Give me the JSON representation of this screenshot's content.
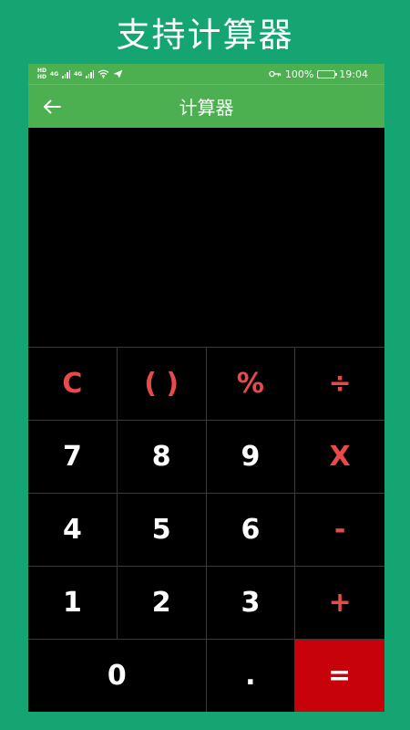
{
  "banner": {
    "title": "支持计算器"
  },
  "statusbar": {
    "hd1": "HD",
    "hd2": "HD",
    "net1": "4G",
    "net2": "4G",
    "battery_text": "100%",
    "time": "19:04"
  },
  "appbar": {
    "title": "计算器"
  },
  "display": {
    "value": ""
  },
  "keys": {
    "clear": "C",
    "parens": "( )",
    "percent": "%",
    "divide": "÷",
    "seven": "7",
    "eight": "8",
    "nine": "9",
    "multiply": "X",
    "four": "4",
    "five": "5",
    "six": "6",
    "minus": "-",
    "one": "1",
    "two": "2",
    "three": "3",
    "plus": "+",
    "zero": "0",
    "dot": ".",
    "equals": "="
  },
  "colors": {
    "banner_bg": "#14a573",
    "appbar_bg": "#4caf50",
    "operator": "#e84a4a",
    "equals_bg": "#c8020b"
  }
}
